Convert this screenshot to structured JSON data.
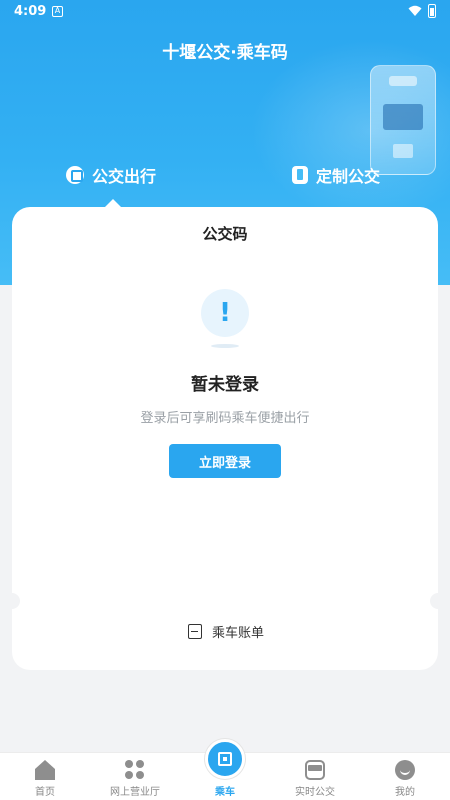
{
  "status_bar": {
    "time": "4:09",
    "notification_letter": "A"
  },
  "header": {
    "title": "十堰公交·乘车码"
  },
  "tabs": [
    {
      "label": "公交出行",
      "icon": "bus-circle-icon",
      "active": true
    },
    {
      "label": "定制公交",
      "icon": "custom-bus-icon",
      "active": false
    }
  ],
  "card": {
    "title": "公交码",
    "empty_state": {
      "icon": "exclamation-icon",
      "icon_glyph": "!",
      "title": "暂未登录",
      "description": "登录后可享刷码乘车便捷出行"
    },
    "login_button": "立即登录",
    "bill_link": "乘车账单"
  },
  "bottom_nav": [
    {
      "label": "首页",
      "icon": "home-icon"
    },
    {
      "label": "网上营业厅",
      "icon": "grid-dots-icon"
    },
    {
      "label": "乘车",
      "icon": "qr-code-icon",
      "active": true
    },
    {
      "label": "实时公交",
      "icon": "bus-icon"
    },
    {
      "label": "我的",
      "icon": "chat-smile-icon"
    }
  ],
  "colors": {
    "primary": "#2aa6ef",
    "background": "#f2f3f5"
  }
}
